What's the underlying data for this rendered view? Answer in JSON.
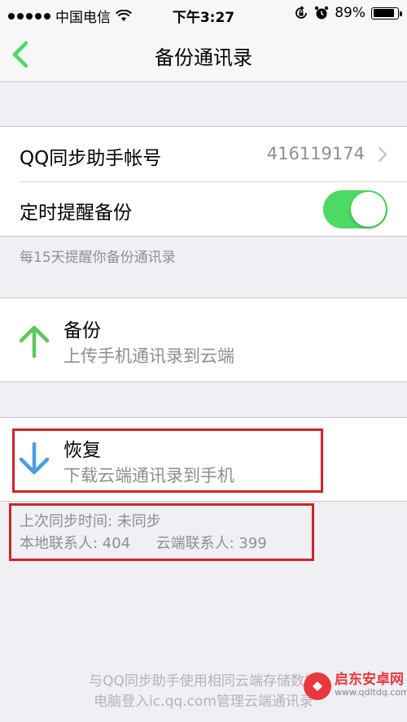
{
  "status_bar": {
    "carrier": "中国电信",
    "time": "下午3:27",
    "battery": "89%",
    "battery_level": 0.89
  },
  "nav": {
    "title": "备份通讯录",
    "back_icon": "chevron-left-icon"
  },
  "account": {
    "label": "QQ同步助手帐号",
    "value": "416119174",
    "chevron_icon": "chevron-right-icon"
  },
  "reminder": {
    "label": "定时提醒备份",
    "enabled": true,
    "note": "每15天提醒你备份通讯录"
  },
  "backup": {
    "title": "备份",
    "subtitle": "上传手机通讯录到云端",
    "icon": "arrow-up-icon",
    "icon_color": "#5cc85c"
  },
  "restore": {
    "title": "恢复",
    "subtitle": "下载云端通讯录到手机",
    "icon": "arrow-down-icon",
    "icon_color": "#4a9ee0"
  },
  "sync_info": {
    "last_sync": "上次同步时间: 未同步",
    "local_contacts": "本地联系人: 404",
    "cloud_contacts": "云端联系人: 399"
  },
  "bottom_info": {
    "line1": "与QQ同步助手使用相同云端存储数据",
    "line2": "电脑登入ic.qq.com管理云端通讯录"
  },
  "watermark": {
    "name": "启东安卓网",
    "url": "www.qdltdq.com"
  },
  "colors": {
    "toggle_on": "#4cd964",
    "highlight_box": "#d1232a",
    "nav_accent": "#4cd964"
  }
}
